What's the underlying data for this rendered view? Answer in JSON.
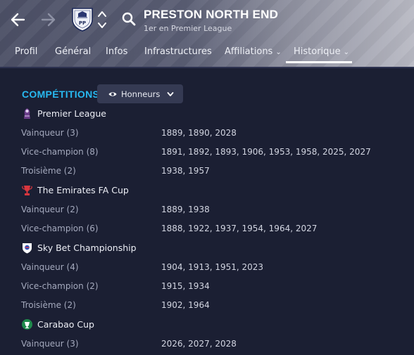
{
  "header": {
    "club_name": "PRESTON NORTH END",
    "subtitle": "1er en Premier League",
    "crest_text": "PP"
  },
  "tabs": [
    {
      "label": "Profil"
    },
    {
      "label": "Général"
    },
    {
      "label": "Infos"
    },
    {
      "label": "Infrastructures"
    },
    {
      "label": "Affiliations",
      "has_dropdown": true
    },
    {
      "label": "Historique",
      "has_dropdown": true,
      "active": true
    }
  ],
  "section": {
    "title": "COMPÉTITIONS",
    "filter_label": "Honneurs"
  },
  "competitions": [
    {
      "name": "Premier League",
      "icon": "premier-league-icon",
      "rows": [
        {
          "label": "Vainqueur",
          "count": "(3)",
          "years": "1889, 1890, 2028"
        },
        {
          "label": "Vice-champion",
          "count": "(8)",
          "years": "1891, 1892, 1893, 1906, 1953, 1958, 2025, 2027"
        },
        {
          "label": "Troisième",
          "count": "(2)",
          "years": "1938, 1957"
        }
      ]
    },
    {
      "name": "The Emirates FA Cup",
      "icon": "fa-cup-icon",
      "rows": [
        {
          "label": "Vainqueur",
          "count": "(2)",
          "years": "1889, 1938"
        },
        {
          "label": "Vice-champion",
          "count": "(6)",
          "years": "1888, 1922, 1937, 1954, 1964, 2027"
        }
      ]
    },
    {
      "name": "Sky Bet Championship",
      "icon": "championship-icon",
      "rows": [
        {
          "label": "Vainqueur",
          "count": "(4)",
          "years": "1904, 1913, 1951, 2023"
        },
        {
          "label": "Vice-champion",
          "count": "(2)",
          "years": "1915, 1934"
        },
        {
          "label": "Troisième",
          "count": "(2)",
          "years": "1902, 1964"
        }
      ]
    },
    {
      "name": "Carabao Cup",
      "icon": "carabao-cup-icon",
      "rows": [
        {
          "label": "Vainqueur",
          "count": "(3)",
          "years": "2026, 2027, 2028"
        }
      ]
    }
  ],
  "colors": {
    "accent": "#28b9f0",
    "background": "#1b1f33"
  }
}
